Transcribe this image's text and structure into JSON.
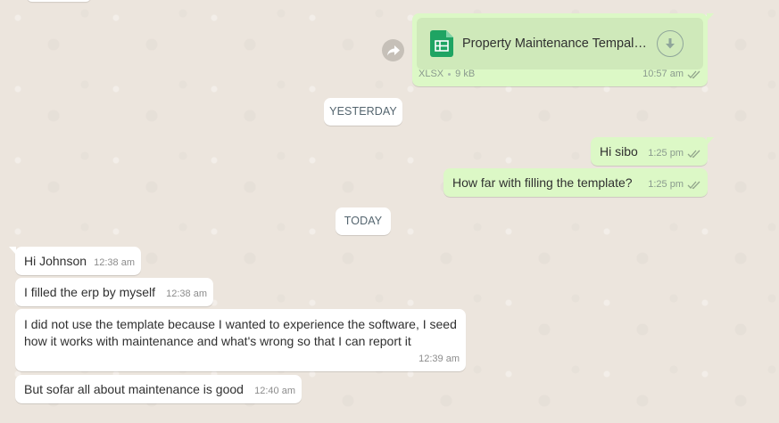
{
  "file_message": {
    "file_name": "Property Maintenance Tempalat...",
    "file_type": "XLSX",
    "file_size": "9 kB",
    "time": "10:57 am",
    "file_icon": "spreadsheet-icon",
    "download_icon": "download-icon",
    "forward_icon": "forward-icon"
  },
  "dates": {
    "yesterday": "YESTERDAY",
    "today": "TODAY"
  },
  "messages": [
    {
      "direction": "outgoing",
      "text": "Hi sibo",
      "time": "1:25 pm",
      "status": "read"
    },
    {
      "direction": "outgoing",
      "text": "How far with filling the template?",
      "time": "1:25 pm",
      "status": "read"
    },
    {
      "direction": "incoming",
      "text": "Hi Johnson",
      "time": "12:38 am"
    },
    {
      "direction": "incoming",
      "text": "I filled the erp by myself",
      "time": "12:38 am"
    },
    {
      "direction": "incoming",
      "text": "I did not use the template because I wanted to experience the software, I seed how it works with maintenance and what's wrong so that I can report it",
      "time": "12:39 am"
    },
    {
      "direction": "incoming",
      "text": "But sofar all about maintenance is good",
      "time": "12:40 am"
    }
  ],
  "colors": {
    "chat_background": "#ECE5DD",
    "outgoing_bubble": "#DCF8C6",
    "incoming_bubble": "#FFFFFF",
    "file_card": "#CFE9BA",
    "spreadsheet_icon": "#1FA463"
  }
}
